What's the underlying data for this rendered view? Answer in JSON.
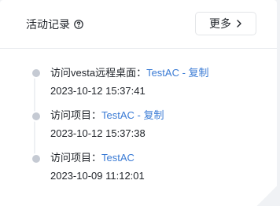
{
  "panel": {
    "title": "活动记录",
    "help_icon": "question-circle-icon",
    "more_label": "更多",
    "more_icon": "chevron-right-icon"
  },
  "activities": [
    {
      "action": "访问vesta远程桌面：",
      "target": "TestAC - 复制",
      "time": "2023-10-12 15:37:41"
    },
    {
      "action": "访问项目：",
      "target": "TestAC - 复制",
      "time": "2023-10-12 15:37:38"
    },
    {
      "action": "访问项目：",
      "target": "TestAC",
      "time": "2023-10-09 11:12:01"
    }
  ],
  "colors": {
    "link": "#3a7bd5",
    "text": "#1f2329",
    "dot": "#c5cad3"
  }
}
